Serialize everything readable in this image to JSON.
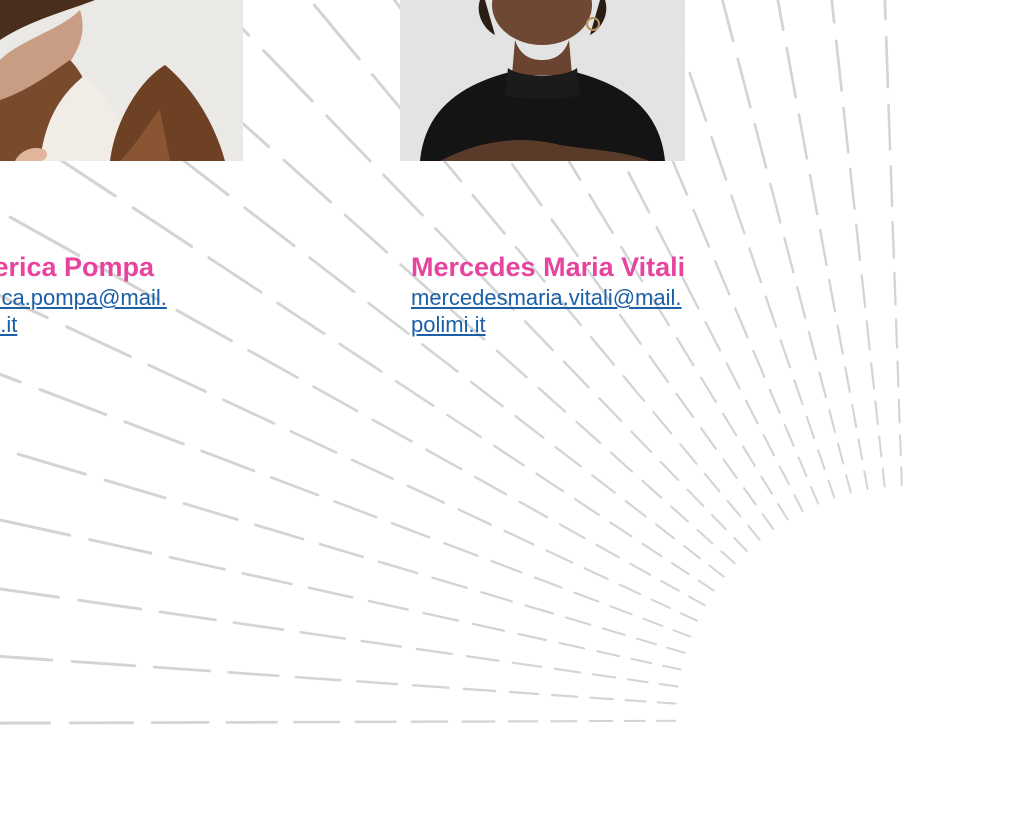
{
  "colors": {
    "name_color": "#e6449f",
    "link_color": "#1a5fa8",
    "burst_line": "#d4d4d4"
  },
  "people": {
    "left": {
      "name": "derica Pompa",
      "email_line1": "erica.pompa@mail.",
      "email_line2": "mi.it"
    },
    "right": {
      "name": "Mercedes Maria Vitali",
      "email_line1": "mercedesmaria.vitali@mail.",
      "email_line2": "polimi.it"
    }
  }
}
